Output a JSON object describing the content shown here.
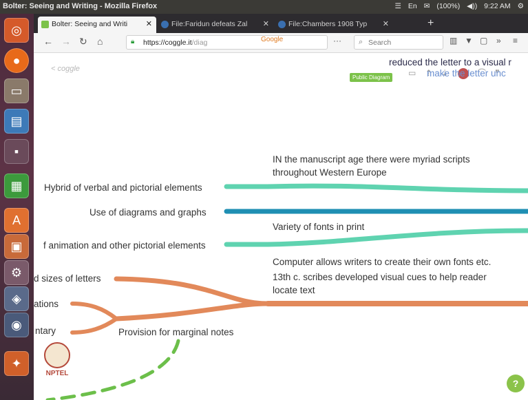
{
  "os_bar": {
    "window_title": "Bolter: Seeing and Writing - Mozilla Firefox",
    "status_items": [
      "☰",
      "En",
      "✉",
      "(100%)",
      "◀))",
      "9:22 AM",
      "⚙"
    ]
  },
  "launcher": {
    "apps": [
      "ubuntu-dash",
      "firefox",
      "files",
      "writer",
      "terminal",
      "calc",
      "software-center",
      "impress",
      "settings",
      "system",
      "media",
      "nptel"
    ]
  },
  "browser": {
    "tabs": [
      {
        "label": "Bolter: Seeing and Writi",
        "active": true
      },
      {
        "label": "File:Faridun defeats Zal",
        "active": false
      },
      {
        "label": "File:Chambers 1908 Typ",
        "active": false
      }
    ],
    "new_tab": "+",
    "url_host": "https://coggle.it",
    "url_path": "/diag",
    "search_engine": "Google",
    "search_placeholder": "Search",
    "page_actions": "···"
  },
  "coggle": {
    "back_label": "< coggle",
    "public_badge": "Public Diagram",
    "help": "?"
  },
  "nodes": {
    "top_right_1": "reduced the letter to a visual r",
    "top_right_2": "make the letter unc",
    "manuscript_1": "IN the manuscript age there were myriad scripts",
    "manuscript_2": "throughout Western Europe",
    "variety_fonts": "Variety of fonts in print",
    "computer_fonts": "Computer allows writers to create their own fonts etc.",
    "scribes_1": "13th c. scribes developed visual cues to help reader",
    "scribes_2": "locate text",
    "hybrid": "Hybrid of verbal and pictorial elements",
    "diagrams": "Use of diagrams and graphs",
    "animation": "f animation and other pictorial elements",
    "sizes": "d sizes of letters",
    "ations": "ations",
    "ntary": "ntary",
    "marginal": "Provision for marginal notes"
  },
  "nptel_label": "NPTEL",
  "colors": {
    "teal": "#5fd3b0",
    "blue_teal": "#1f8fb3",
    "orange": "#e2895a",
    "green_dash": "#6cbf4a"
  }
}
